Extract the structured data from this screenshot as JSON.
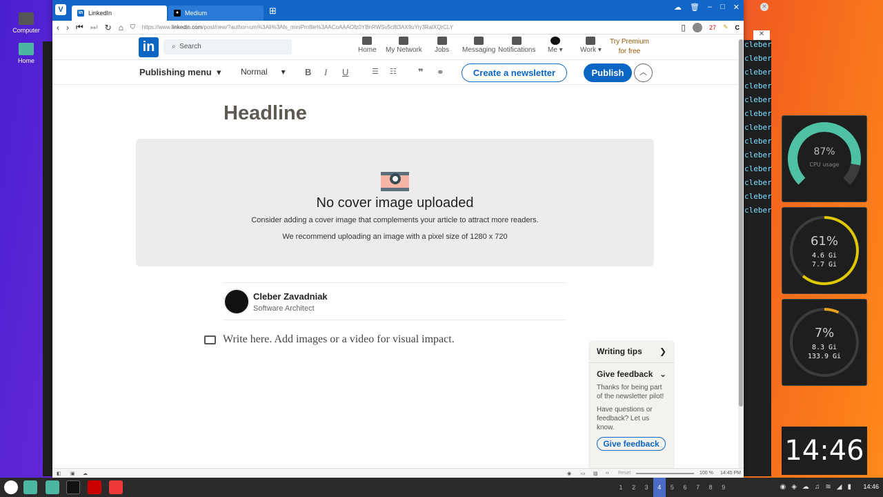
{
  "desktop": {
    "icons": [
      {
        "label": "Computer"
      },
      {
        "label": "Home"
      }
    ]
  },
  "browser": {
    "tabs": [
      {
        "label": "LinkedIn"
      },
      {
        "label": "Medium"
      }
    ],
    "address": {
      "scheme": "https://www.",
      "domain": "linkedin.com",
      "path": "/post/new/?author=urn%3Ali%3Afs_miniProfile%3AACoAAAOfz0YBnRWSv5c8t3AX9uYiy3RalXQrCLY"
    },
    "badge_count": "27"
  },
  "linkedin": {
    "search_placeholder": "Search",
    "nav": {
      "home": "Home",
      "network": "My Network",
      "jobs": "Jobs",
      "messaging": "Messaging",
      "notifications": "Notifications",
      "me": "Me",
      "work": "Work"
    },
    "premium": {
      "line1": "Try Premium",
      "line2": "for free"
    }
  },
  "editor": {
    "publishing_menu": "Publishing menu",
    "style": "Normal",
    "create_newsletter": "Create a newsletter",
    "publish": "Publish",
    "headline_placeholder": "Headline",
    "cover": {
      "title": "No cover image uploaded",
      "line1": "Consider adding a cover image that complements your article to attract more readers.",
      "line2": "We recommend uploading an image with a pixel size of 1280 x 720"
    },
    "author": {
      "name": "Cleber Zavadniak",
      "role": "Software Architect"
    },
    "body_placeholder": "Write here. Add images or a video for visual impact."
  },
  "tips_panel": {
    "writing_tips": "Writing tips",
    "give_feedback_header": "Give feedback",
    "thanks": "Thanks for being part of the newsletter pilot!",
    "questions": "Have questions or feedback? Let us know.",
    "give_feedback_button": "Give feedback"
  },
  "statusbar": {
    "reset": "Reset",
    "zoom": "100 %",
    "time": "14:45 PM"
  },
  "widgets": {
    "cpu": {
      "percent": "87%",
      "label": "CPU usage",
      "fraction": 0.87
    },
    "mem": {
      "percent": "61%",
      "used": "4.6 Gi",
      "total": "7.7 Gi",
      "fraction": 0.61
    },
    "disk": {
      "percent": "7%",
      "used": "8.3 Gi",
      "total": "133.9 Gi",
      "fraction": 0.07
    },
    "clock": "14:46"
  },
  "taskbar": {
    "workspaces": [
      "1",
      "2",
      "3",
      "4",
      "5",
      "6",
      "7",
      "8",
      "9"
    ],
    "active_workspace": "4",
    "time": "14:46"
  },
  "terminal": {
    "prompt": "cleber@"
  }
}
